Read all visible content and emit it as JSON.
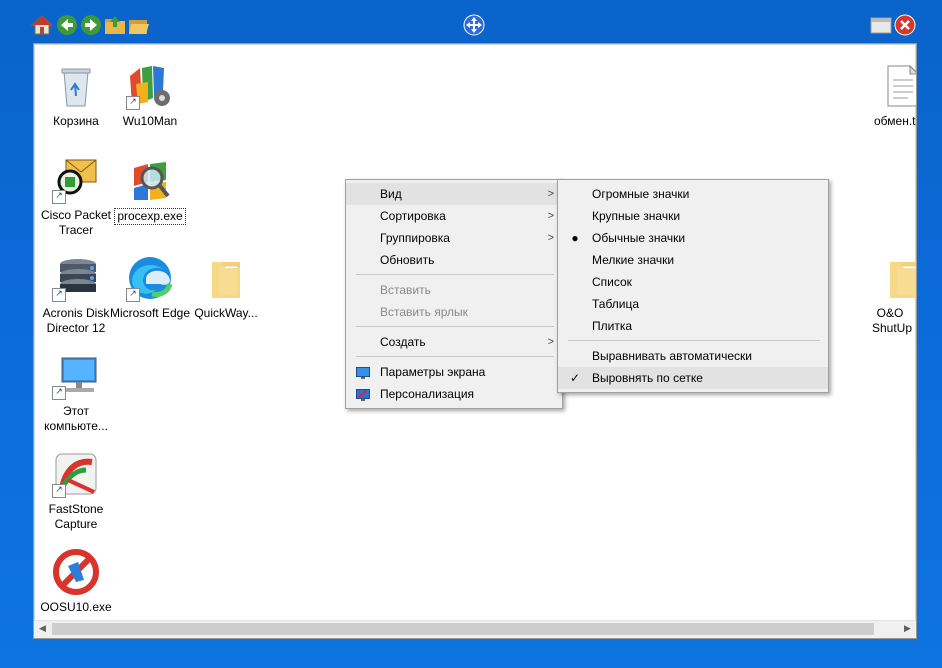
{
  "toolbar": {
    "icons": [
      "home-icon",
      "back-icon",
      "forward-icon",
      "folder-up-icon",
      "folder-open-icon",
      "move-icon",
      "restore-icon",
      "close-icon"
    ]
  },
  "desktop": {
    "icons": [
      {
        "label": "Корзина",
        "name": "recycle-bin"
      },
      {
        "label": "Wu10Man",
        "name": "wu10man"
      },
      {
        "label": "Cisco Packet Tracer",
        "name": "cisco-packet-tracer"
      },
      {
        "label": "procexp.exe",
        "name": "procexp"
      },
      {
        "label": "Acronis Disk Director 12",
        "name": "acronis-disk-director"
      },
      {
        "label": "Microsoft Edge",
        "name": "microsoft-edge"
      },
      {
        "label": "QuickWay...",
        "name": "quickway-folder"
      },
      {
        "label": "Этот компьюте...",
        "name": "this-pc"
      },
      {
        "label": "FastStone Capture",
        "name": "faststone-capture"
      },
      {
        "label": "OOSU10.exe",
        "name": "oosu10"
      },
      {
        "label": "обмен.t",
        "name": "obmen-file"
      },
      {
        "label": "O&O ShutUp",
        "name": "oo-shutup"
      }
    ]
  },
  "context_menu": {
    "items": [
      {
        "label": "Вид",
        "submenu": true
      },
      {
        "label": "Сортировка",
        "submenu": true
      },
      {
        "label": "Группировка",
        "submenu": true
      },
      {
        "label": "Обновить"
      },
      {
        "label": "Вставить",
        "disabled": true
      },
      {
        "label": "Вставить ярлык",
        "disabled": true
      },
      {
        "label": "Создать",
        "submenu": true
      },
      {
        "label": "Параметры экрана"
      },
      {
        "label": "Персонализация"
      }
    ]
  },
  "view_submenu": {
    "items": [
      {
        "label": "Огромные значки"
      },
      {
        "label": "Крупные значки"
      },
      {
        "label": "Обычные значки",
        "selected": true
      },
      {
        "label": "Мелкие значки"
      },
      {
        "label": "Список"
      },
      {
        "label": "Таблица"
      },
      {
        "label": "Плитка"
      },
      {
        "label": "Выравнивать автоматически"
      },
      {
        "label": "Выровнять по сетке",
        "checked": true
      }
    ]
  },
  "colors": {
    "desktop_bg": "#0b6ad8",
    "menu_bg": "#f0f0f0",
    "highlight": "#e2e2e2"
  }
}
